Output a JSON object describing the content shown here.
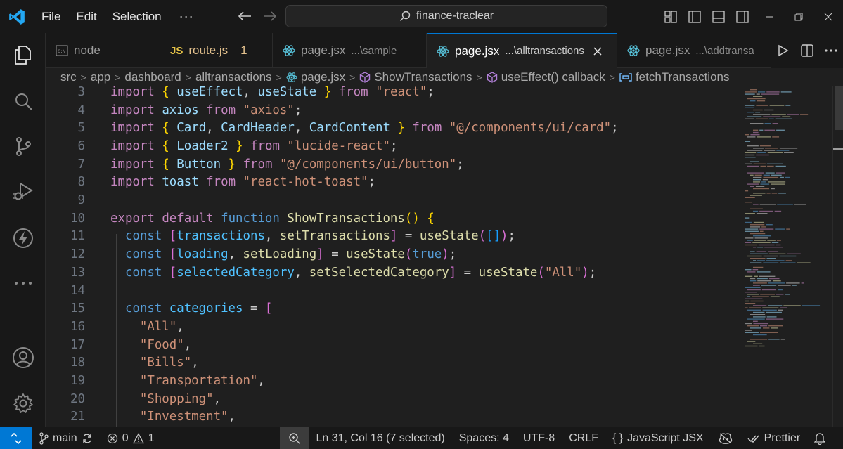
{
  "colors": {
    "accent": "#0078d4",
    "modified": "#e2c08d",
    "js_badge": "#e8c547",
    "react_icon": "#58c4dc"
  },
  "menu": {
    "file": "File",
    "edit": "Edit",
    "selection": "Selection",
    "more": "···"
  },
  "command_center": {
    "text": "finance-traclear"
  },
  "tabs": [
    {
      "label": "node",
      "icon": "terminal-icon"
    },
    {
      "label": "route.js",
      "icon": "js-file-icon",
      "badge": "JS",
      "problems": "1"
    },
    {
      "label": "page.jsx",
      "description": "...\\sample",
      "icon": "react-icon"
    },
    {
      "label": "page.jsx",
      "description": "...\\alltransactions",
      "icon": "react-icon",
      "active": true
    },
    {
      "label": "page.jsx",
      "description": "...\\addtransa",
      "icon": "react-icon"
    }
  ],
  "breadcrumbs": {
    "items": [
      "src",
      "app",
      "dashboard",
      "alltransactions",
      "page.jsx",
      "ShowTransactions",
      "useEffect() callback",
      "fetchTransactions"
    ]
  },
  "editor": {
    "line_numbers": [
      "3",
      "4",
      "5",
      "6",
      "7",
      "8",
      "9",
      "10",
      "11",
      "12",
      "13",
      "14",
      "15",
      "16",
      "17",
      "18",
      "19",
      "20",
      "21"
    ]
  },
  "statusbar": {
    "branch": "main",
    "errors": "0",
    "warnings": "1",
    "cursor": "Ln 31, Col 16 (7 selected)",
    "spaces": "Spaces: 4",
    "encoding": "UTF-8",
    "eol": "CRLF",
    "language_braces": "{ }",
    "language": "JavaScript JSX",
    "prettier": "Prettier"
  }
}
